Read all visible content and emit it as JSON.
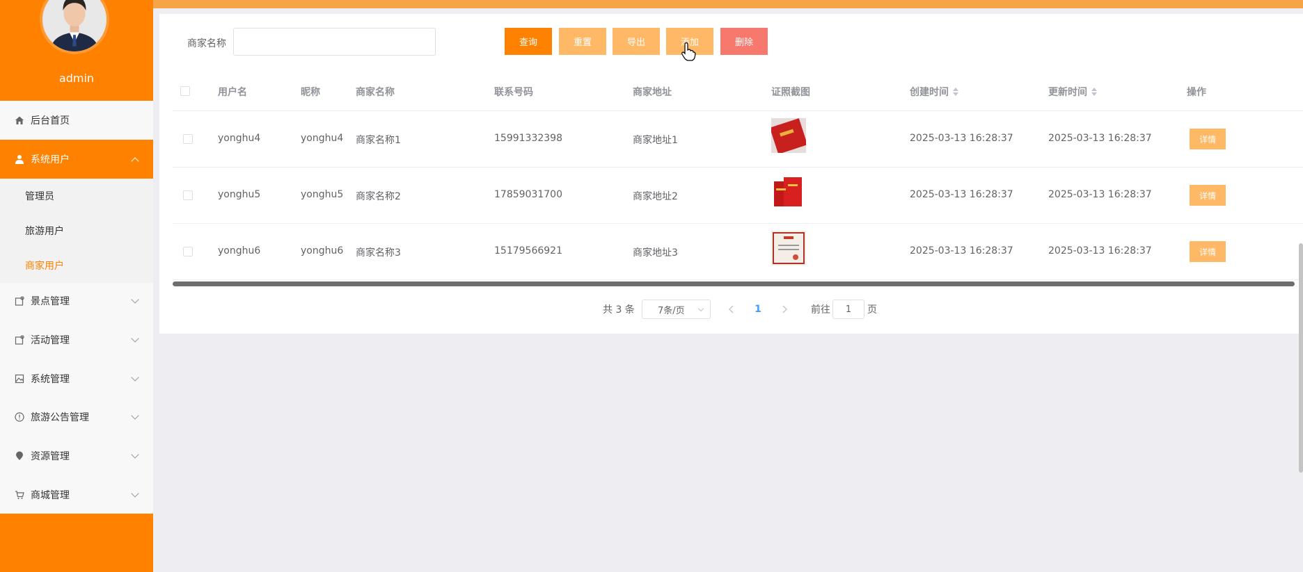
{
  "sidebar": {
    "admin_name": "admin",
    "menu": [
      {
        "label": "后台首页",
        "icon": "home-icon"
      },
      {
        "label": "系统用户",
        "icon": "user-icon"
      },
      {
        "label": "景点管理",
        "icon": "tag-icon"
      },
      {
        "label": "活动管理",
        "icon": "tag-icon"
      },
      {
        "label": "系统管理",
        "icon": "picture-icon"
      },
      {
        "label": "旅游公告管理",
        "icon": "info-icon"
      },
      {
        "label": "资源管理",
        "icon": "location-icon"
      },
      {
        "label": "商城管理",
        "icon": "cart-icon"
      }
    ],
    "submenu": [
      {
        "label": "管理员"
      },
      {
        "label": "旅游用户"
      },
      {
        "label": "商家用户"
      }
    ]
  },
  "search": {
    "label": "商家名称",
    "value": ""
  },
  "toolbar": {
    "query": "查询",
    "reset": "重置",
    "export": "导出",
    "add": "添加",
    "delete": "删除"
  },
  "table": {
    "headers": [
      "用户名",
      "昵称",
      "商家名称",
      "联系号码",
      "商家地址",
      "证照截图",
      "创建时间",
      "更新时间",
      "操作"
    ],
    "rows": [
      {
        "username": "yonghu4",
        "nickname": "yonghu4",
        "shop": "商家名称1",
        "phone": "15991332398",
        "address": "商家地址1",
        "created": "2025-03-13 16:28:37",
        "updated": "2025-03-13 16:28:37",
        "action": "详情"
      },
      {
        "username": "yonghu5",
        "nickname": "yonghu5",
        "shop": "商家名称2",
        "phone": "17859031700",
        "address": "商家地址2",
        "created": "2025-03-13 16:28:37",
        "updated": "2025-03-13 16:28:37",
        "action": "详情"
      },
      {
        "username": "yonghu6",
        "nickname": "yonghu6",
        "shop": "商家名称3",
        "phone": "15179566921",
        "address": "商家地址3",
        "created": "2025-03-13 16:28:37",
        "updated": "2025-03-13 16:28:37",
        "action": "详情"
      }
    ]
  },
  "pagination": {
    "total": "共 3 条",
    "page_size": "7条/页",
    "current": "1",
    "goto_label": "前往",
    "goto_value": "1",
    "page_suffix": "页"
  }
}
